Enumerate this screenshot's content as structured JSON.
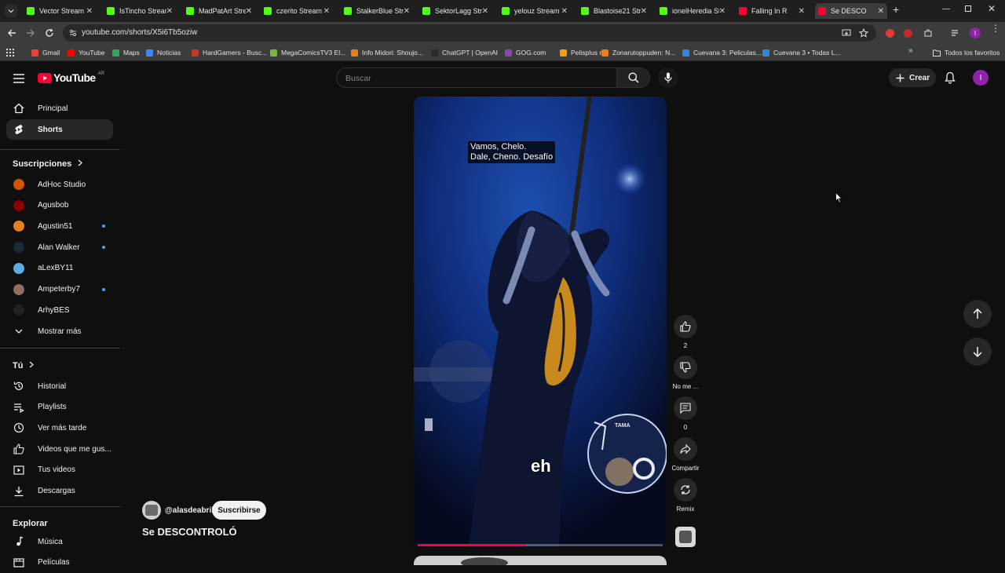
{
  "browser": {
    "tabs": [
      {
        "title": "Vector Stream",
        "color": "#53fc18"
      },
      {
        "title": "IsTincho Stream",
        "color": "#53fc18"
      },
      {
        "title": "MadPatArt Stre",
        "color": "#53fc18"
      },
      {
        "title": "czerito Stream",
        "color": "#53fc18"
      },
      {
        "title": "StalkerBlue Stre",
        "color": "#53fc18"
      },
      {
        "title": "SektorLagg Str",
        "color": "#53fc18"
      },
      {
        "title": "yelouz Stream",
        "color": "#53fc18"
      },
      {
        "title": "Blastoise21 Str",
        "color": "#53fc18"
      },
      {
        "title": "ionelHeredia St",
        "color": "#53fc18"
      },
      {
        "title": "Falling In R",
        "color": "#ff0033"
      },
      {
        "title": "Se DESCO",
        "color": "#ff0033"
      }
    ],
    "url": "youtube.com/shorts/X5i6Tb5oziw",
    "bookmarks": [
      {
        "label": "Gmail",
        "color": "#ea4335"
      },
      {
        "label": "YouTube",
        "color": "#ff0000"
      },
      {
        "label": "Maps",
        "color": "#34a853"
      },
      {
        "label": "Noticias",
        "color": "#4285f4"
      },
      {
        "label": "HardGamers - Busc...",
        "color": "#c0392b"
      },
      {
        "label": "MegaComicsTV3 El...",
        "color": "#7cb342"
      },
      {
        "label": "Info Midori: Shoujo...",
        "color": "#e67e22"
      },
      {
        "label": "ChatGPT | OpenAI",
        "color": "#2b2b2b"
      },
      {
        "label": "GOG.com",
        "color": "#8e44ad"
      },
      {
        "label": "Pelisplus rip",
        "color": "#f39c12"
      },
      {
        "label": "Zonarutoppuden: N...",
        "color": "#e67e22"
      },
      {
        "label": "Cuevana 3: Peliculas...",
        "color": "#2e86de"
      },
      {
        "label": "Cuevana 3 • Todas L...",
        "color": "#2e86de"
      }
    ],
    "all_bookmarks": "Todos los favoritos",
    "profile_initial": "I"
  },
  "youtube": {
    "logo": "YouTube",
    "country": "AR",
    "search_placeholder": "Buscar",
    "create_label": "Crear",
    "user_initial": "I"
  },
  "sidebar": {
    "main": [
      {
        "label": "Principal",
        "icon": "home-icon"
      },
      {
        "label": "Shorts",
        "icon": "shorts-icon"
      }
    ],
    "subs_title": "Suscripciones",
    "subs": [
      {
        "label": "AdHoc Studio",
        "color": "#d35400",
        "live": false
      },
      {
        "label": "Agusbob",
        "color": "#8b0000",
        "live": false
      },
      {
        "label": "Agustin51",
        "color": "#e67e22",
        "live": true
      },
      {
        "label": "Alan Walker",
        "color": "#1a2a3a",
        "live": true
      },
      {
        "label": "aLexBY11",
        "color": "#5dade2",
        "live": false
      },
      {
        "label": "Ampeterby7",
        "color": "#8d6e63",
        "live": true
      },
      {
        "label": "ArhyBES",
        "color": "#212121",
        "live": false
      }
    ],
    "show_more": "Mostrar más",
    "you_title": "Tú",
    "you": [
      {
        "label": "Historial",
        "icon": "history-icon"
      },
      {
        "label": "Playlists",
        "icon": "playlists-icon"
      },
      {
        "label": "Ver más tarde",
        "icon": "clock-icon"
      },
      {
        "label": "Videos que me gus...",
        "icon": "like-icon"
      },
      {
        "label": "Tus videos",
        "icon": "video-icon"
      },
      {
        "label": "Descargas",
        "icon": "download-icon"
      }
    ],
    "explore_title": "Explorar",
    "explore": [
      {
        "label": "Música",
        "icon": "music-icon"
      },
      {
        "label": "Películas",
        "icon": "film-icon"
      }
    ]
  },
  "short": {
    "caption_line1": "Vamos, Chelo.",
    "caption_line2": "Dale, Cheno. Desafío",
    "lyric": "eh",
    "drum_brand": "TAMA",
    "channel": "@alasdeabril",
    "subscribe": "Suscribirse",
    "title": "Se DESCONTROLÓ",
    "progress": 0.44,
    "actions": {
      "likes": "2",
      "dislike": "No me ...",
      "comments": "0",
      "share": "Compartir",
      "remix": "Remix"
    }
  }
}
